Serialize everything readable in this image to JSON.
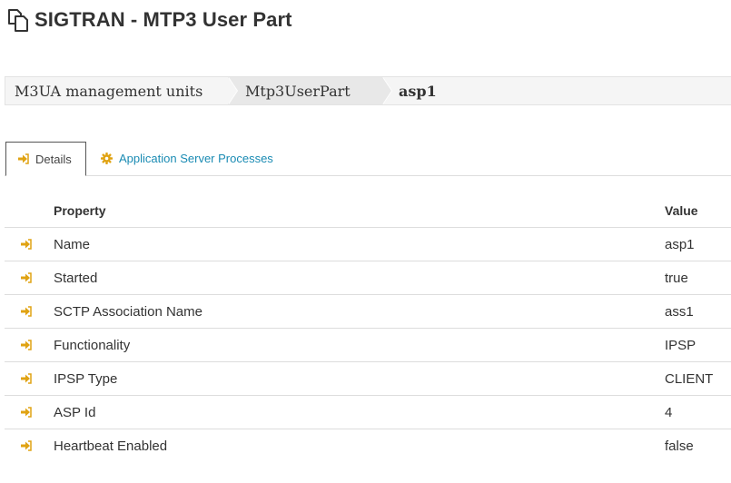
{
  "page": {
    "title": "SIGTRAN - MTP3 User Part"
  },
  "breadcrumb": {
    "items": [
      {
        "label": "M3UA management units"
      },
      {
        "label": "Mtp3UserPart"
      },
      {
        "label": "asp1"
      }
    ]
  },
  "tabs": [
    {
      "label": "Details",
      "icon": "sign-in-icon",
      "active": true
    },
    {
      "label": "Application Server Processes",
      "icon": "gear-icon",
      "active": false
    }
  ],
  "table": {
    "headers": {
      "property": "Property",
      "value": "Value"
    },
    "rows": [
      {
        "property": "Name",
        "value": "asp1"
      },
      {
        "property": "Started",
        "value": "true"
      },
      {
        "property": "SCTP Association Name",
        "value": "ass1"
      },
      {
        "property": "Functionality",
        "value": "IPSP"
      },
      {
        "property": "IPSP Type",
        "value": "CLIENT"
      },
      {
        "property": "ASP Id",
        "value": "4"
      },
      {
        "property": "Heartbeat Enabled",
        "value": "false"
      }
    ]
  },
  "colors": {
    "accent_icon": "#e0a313",
    "link": "#1a8bb3"
  }
}
